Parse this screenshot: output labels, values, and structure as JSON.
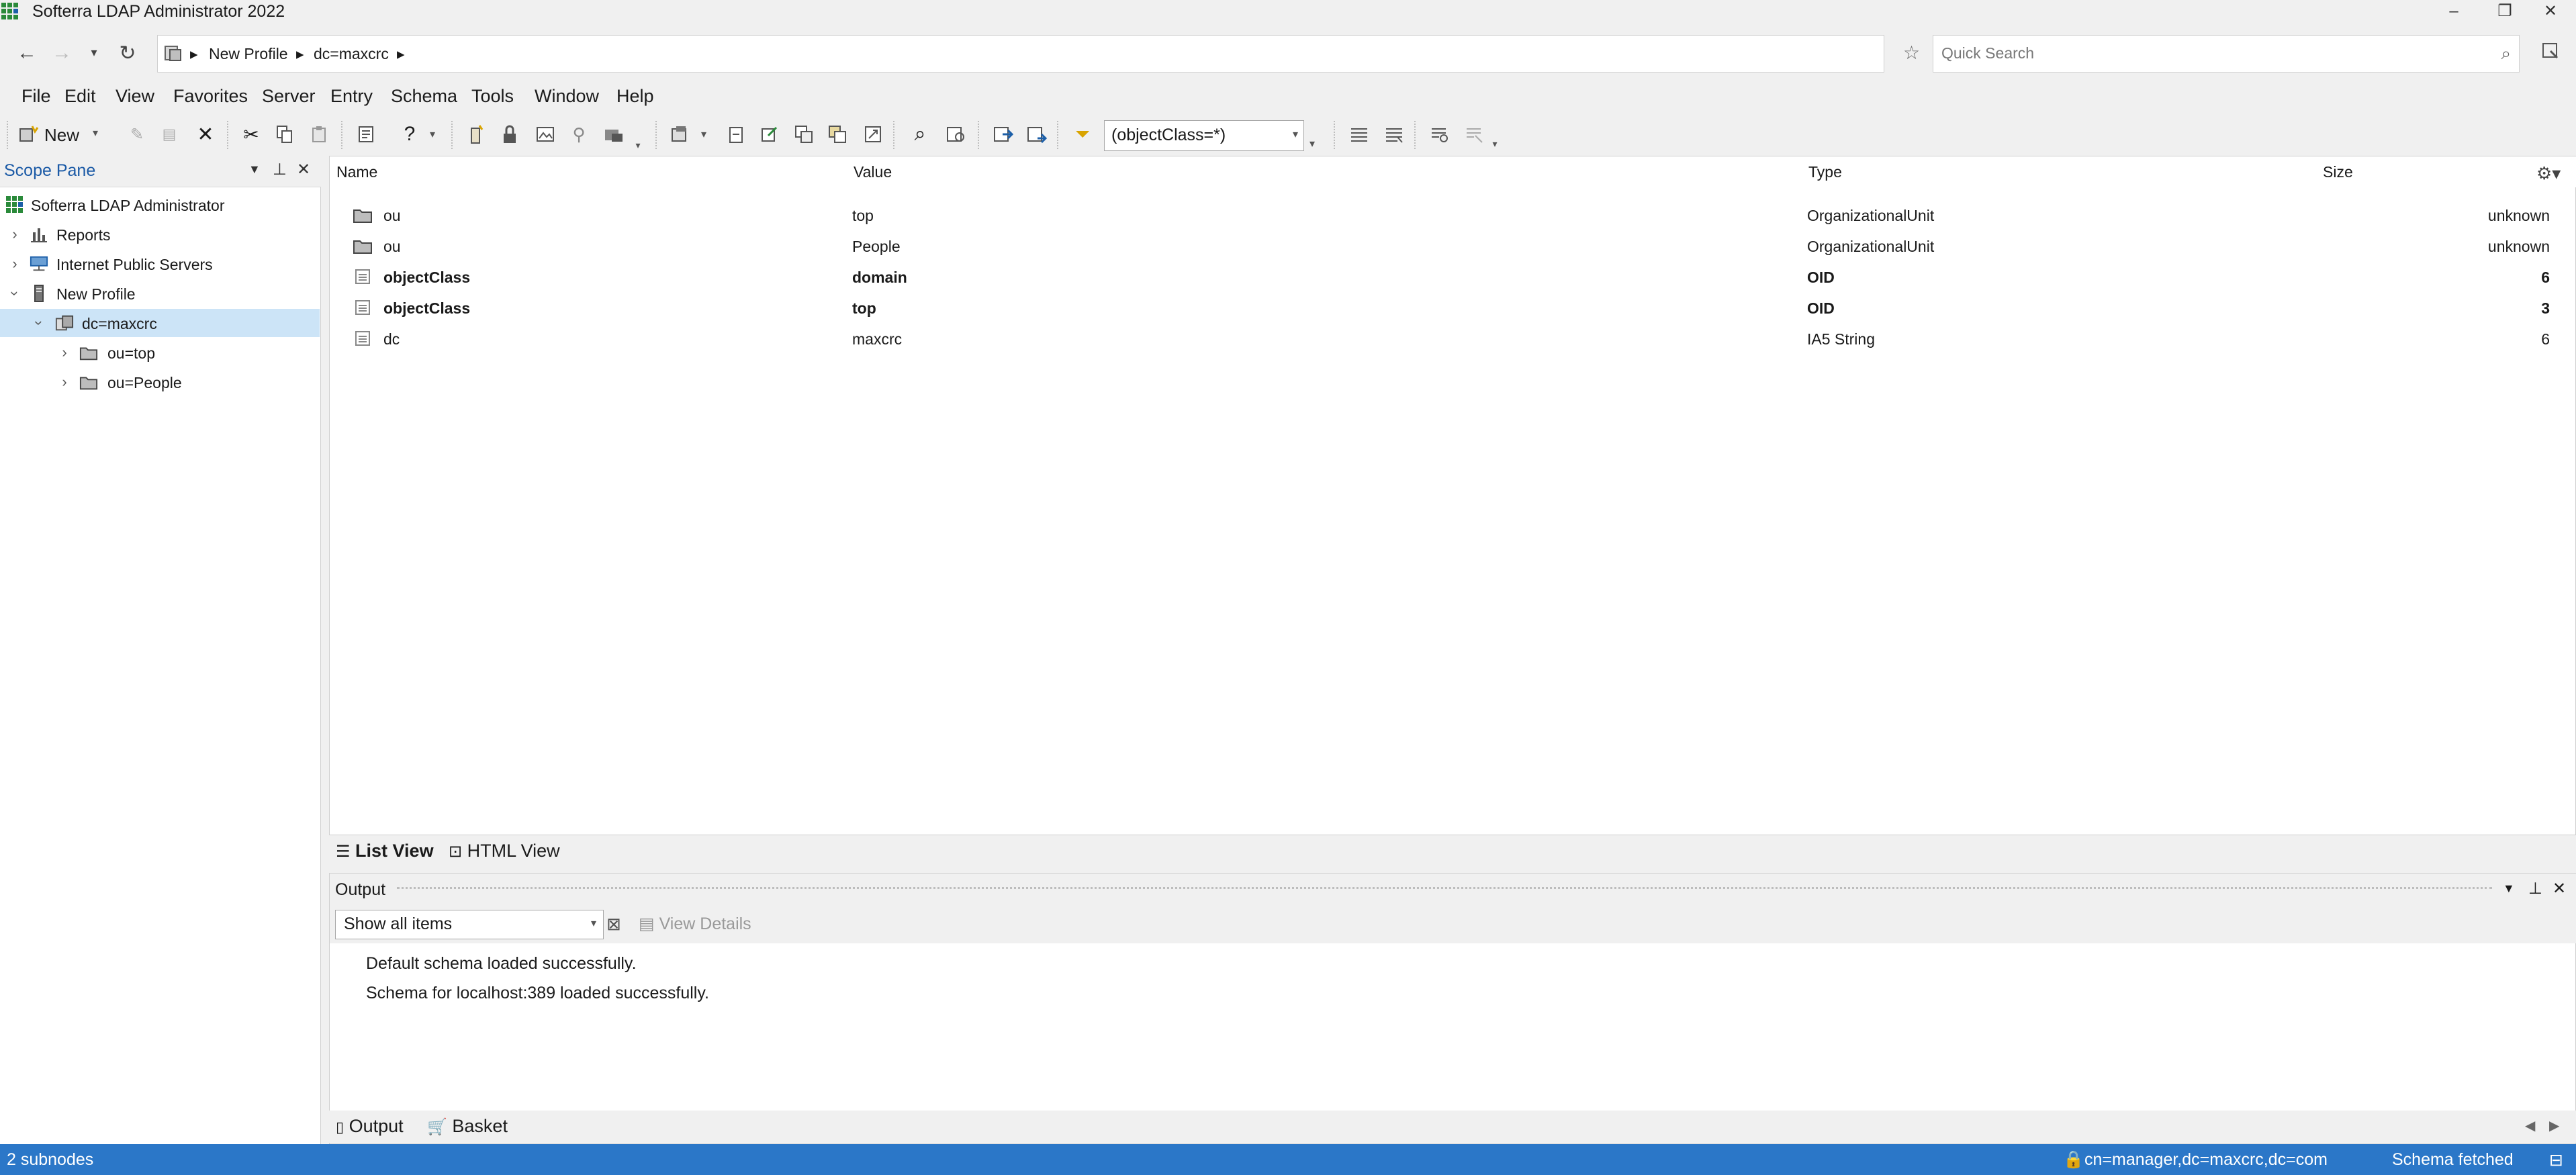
{
  "window": {
    "title": "Softerra LDAP Administrator 2022",
    "controls": {
      "minimize": "–",
      "restore": "❐",
      "close": "✕"
    }
  },
  "address_bar": {
    "breadcrumb": [
      "New Profile",
      "dc=maxcrc"
    ],
    "search_placeholder": "Quick Search"
  },
  "menu": [
    "File",
    "Edit",
    "View",
    "Favorites",
    "Server",
    "Entry",
    "Schema",
    "Tools",
    "Window",
    "Help"
  ],
  "toolbar": {
    "new_label": "New",
    "filter_value": "(objectClass=*)"
  },
  "scope_pane": {
    "title": "Scope Pane",
    "tree": [
      {
        "label": "Softerra LDAP Administrator",
        "icon": "app-grid-icon"
      },
      {
        "label": "Reports",
        "icon": "reports-icon"
      },
      {
        "label": "Internet Public Servers",
        "icon": "network-servers-icon"
      },
      {
        "label": "New Profile",
        "icon": "server-icon"
      },
      {
        "label": "dc=maxcrc",
        "icon": "domain-icon",
        "selected": true
      },
      {
        "label": "ou=top",
        "icon": "folder-icon"
      },
      {
        "label": "ou=People",
        "icon": "folder-icon"
      }
    ]
  },
  "list_view": {
    "columns": [
      "Name",
      "Value",
      "Type",
      "Size"
    ],
    "rows": [
      {
        "name": "ou",
        "value": "top",
        "type": "OrganizationalUnit",
        "size": "unknown",
        "icon": "folder-icon",
        "bold": false
      },
      {
        "name": "ou",
        "value": "People",
        "type": "OrganizationalUnit",
        "size": "unknown",
        "icon": "folder-icon",
        "bold": false
      },
      {
        "name": "objectClass",
        "value": "domain",
        "type": "OID",
        "size": "6",
        "icon": "attribute-icon",
        "bold": true
      },
      {
        "name": "objectClass",
        "value": "top",
        "type": "OID",
        "size": "3",
        "icon": "attribute-icon",
        "bold": true
      },
      {
        "name": "dc",
        "value": "maxcrc",
        "type": "IA5 String",
        "size": "6",
        "icon": "attribute-icon",
        "bold": false
      }
    ]
  },
  "view_tabs": [
    "List View",
    "HTML View"
  ],
  "output": {
    "title": "Output",
    "filter_selected": "Show all items",
    "view_details": "View Details",
    "lines": [
      "Default schema loaded successfully.",
      "Schema for localhost:389 loaded successfully."
    ],
    "tabs": [
      "Output",
      "Basket"
    ]
  },
  "status_bar": {
    "left": "2 subnodes",
    "user": "cn=manager,dc=maxcrc,dc=com",
    "state": "Schema fetched"
  }
}
